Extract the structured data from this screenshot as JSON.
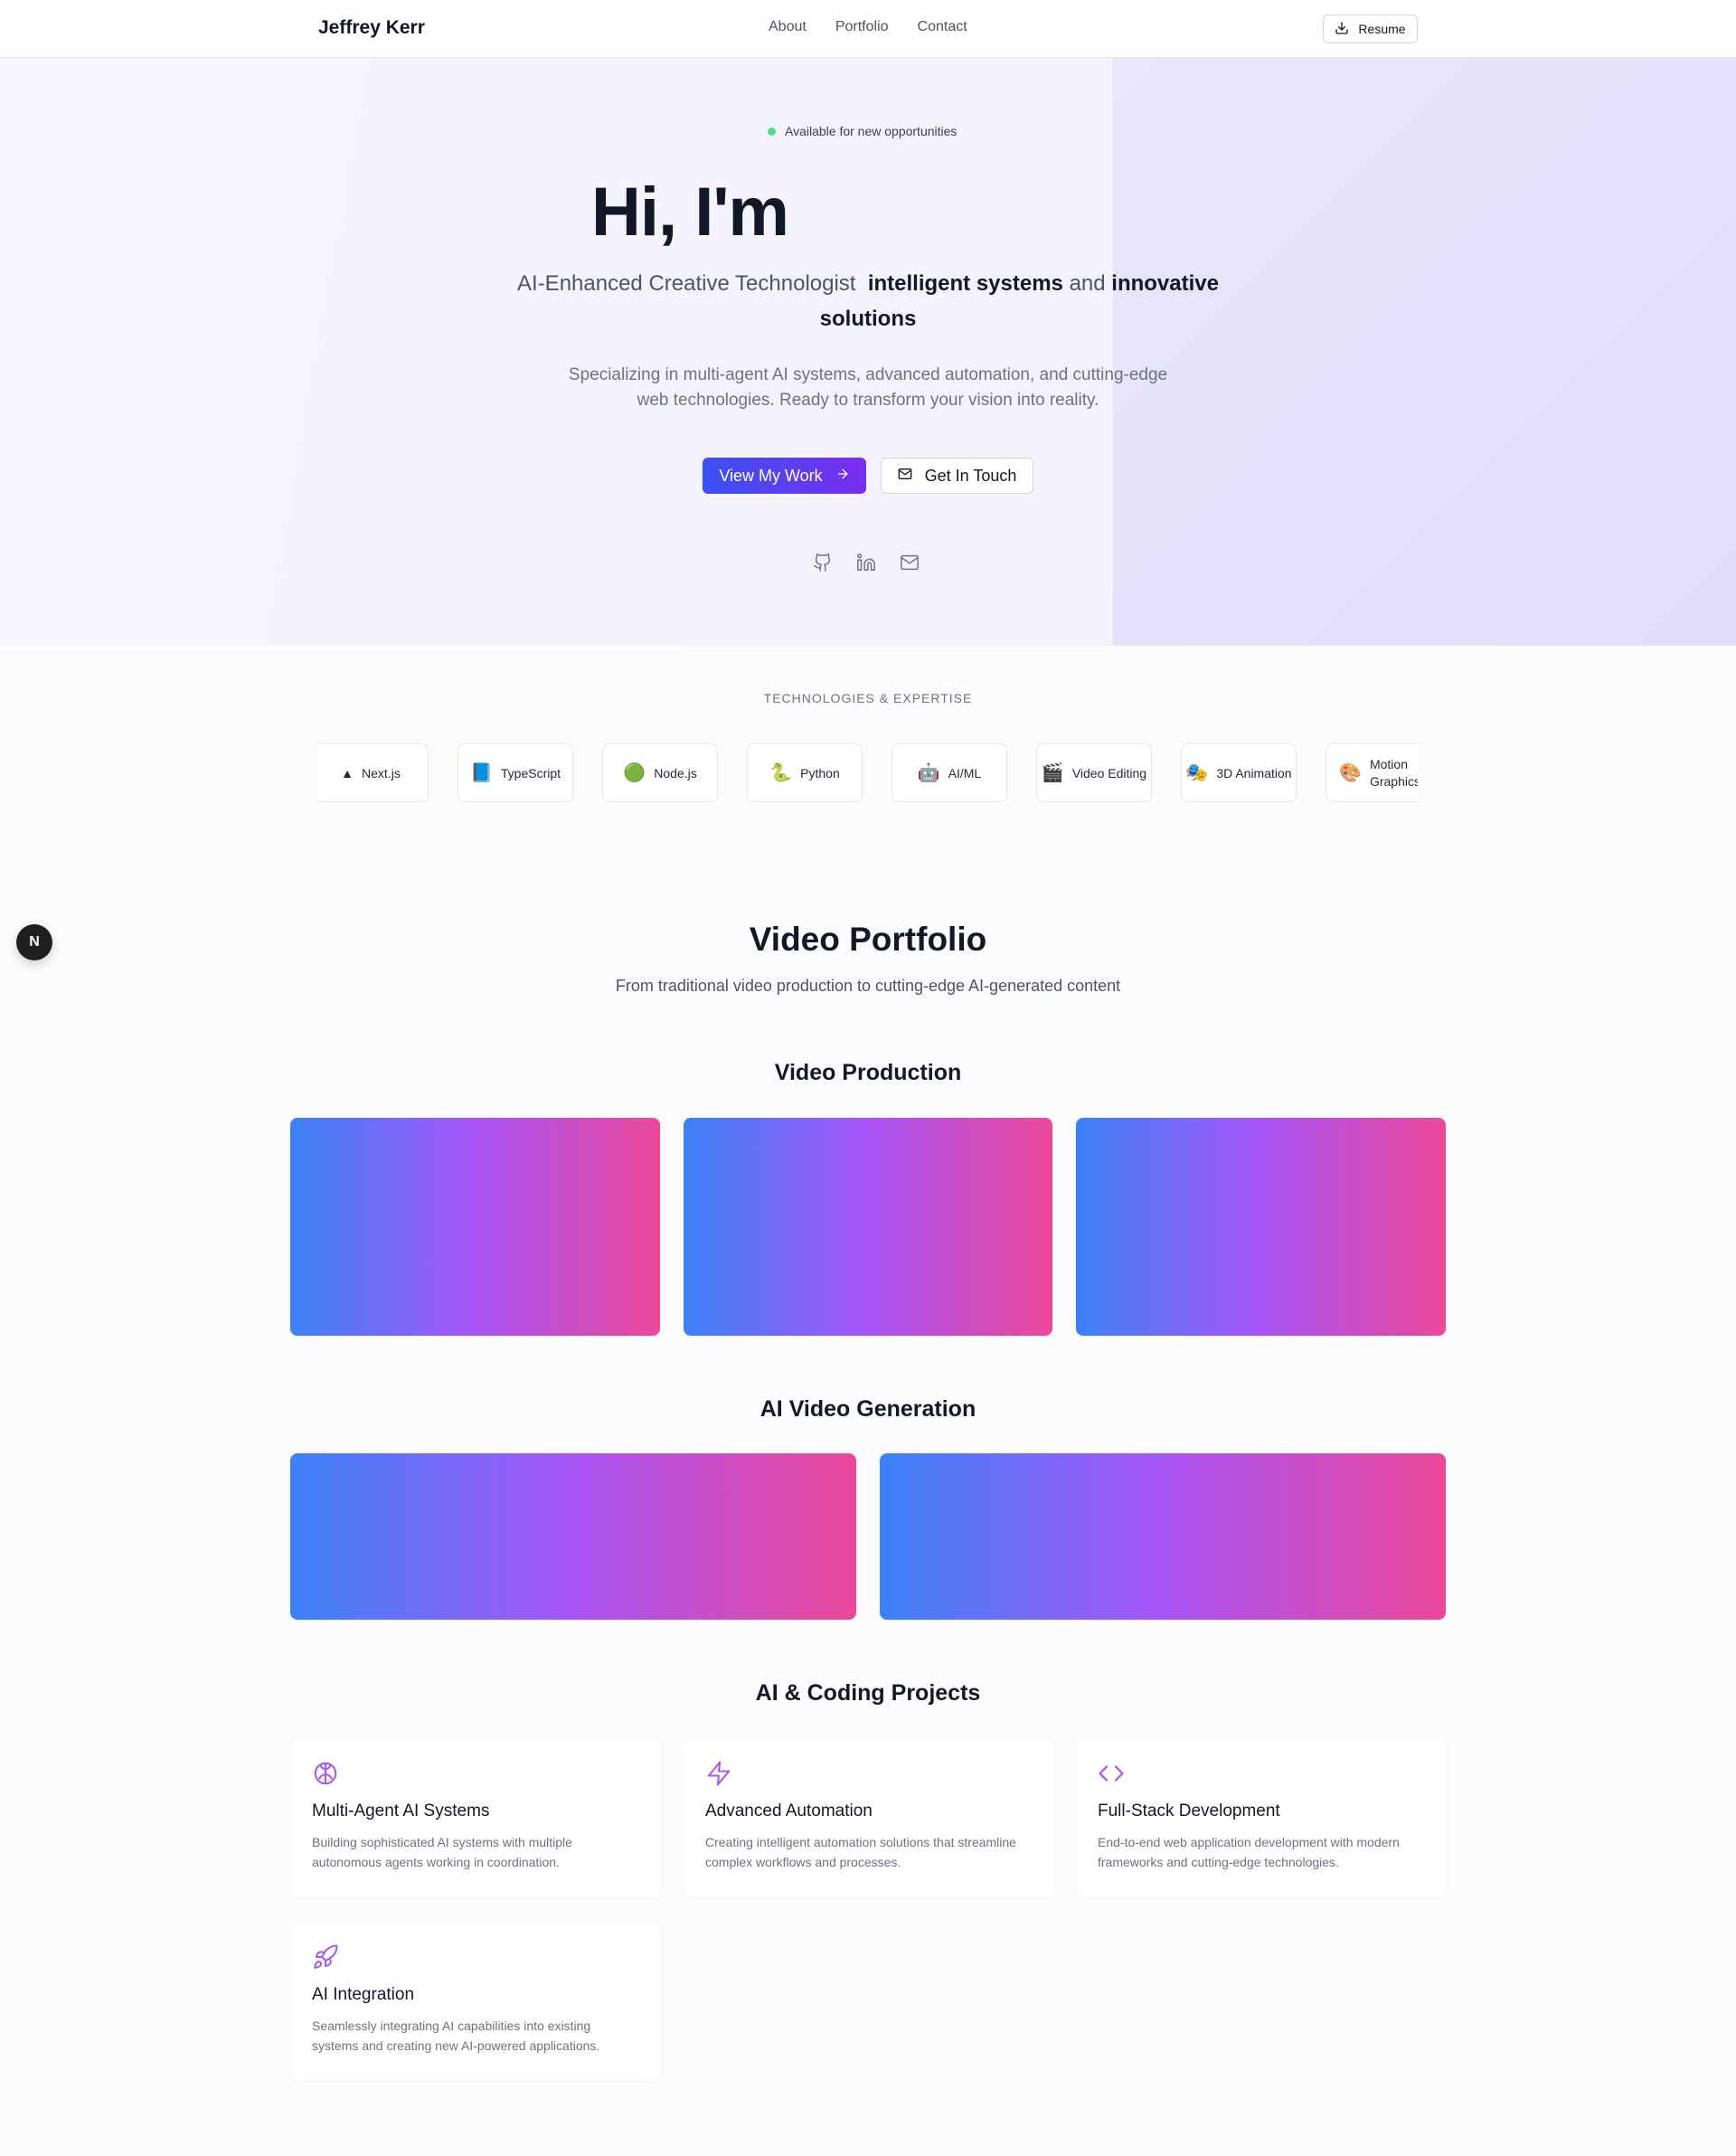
{
  "nav": {
    "brand": "Jeffrey Kerr",
    "links": [
      "About",
      "Portfolio",
      "Contact"
    ],
    "resume_label": "Resume"
  },
  "hero": {
    "availability": "Available for new opportunities",
    "greeting": "Hi, I'm",
    "subtitle_plain_1": "AI-Enhanced Creative Technologist",
    "subtitle_bold_1": "intelligent systems",
    "subtitle_plain_2": "and",
    "subtitle_bold_2": "innovative solutions",
    "description": "Specializing in multi-agent AI systems, advanced automation, and cutting-edge web technologies. Ready to transform your vision into reality.",
    "primary_cta": "View My Work",
    "secondary_cta": "Get In Touch",
    "social_icons": [
      "github-icon",
      "linkedin-icon",
      "mail-icon"
    ]
  },
  "tech": {
    "title": "TECHNOLOGIES & EXPERTISE",
    "items": [
      {
        "emoji": "▲",
        "label": "Next.js"
      },
      {
        "emoji": "📘",
        "label": "TypeScript"
      },
      {
        "emoji": "🟢",
        "label": "Node.js"
      },
      {
        "emoji": "🐍",
        "label": "Python"
      },
      {
        "emoji": "🤖",
        "label": "AI/ML"
      },
      {
        "emoji": "🎬",
        "label": "Video Editing"
      },
      {
        "emoji": "🎭",
        "label": "3D Animation"
      },
      {
        "emoji": "🎨",
        "label": "Motion Graphics"
      }
    ]
  },
  "floating_badge": "N",
  "portfolio": {
    "title": "Video Portfolio",
    "subtitle": "From traditional video production to cutting-edge AI-generated content",
    "video_production_heading": "Video Production",
    "ai_video_heading": "AI Video Generation",
    "coding_heading": "AI & Coding Projects",
    "gradient_colors": [
      "#3b82f6",
      "#a855f7",
      "#ec4899"
    ]
  },
  "projects": [
    {
      "icon": "brain-icon",
      "title": "Multi-Agent AI Systems",
      "description": "Building sophisticated AI systems with multiple autonomous agents working in coordination."
    },
    {
      "icon": "zap-icon",
      "title": "Advanced Automation",
      "description": "Creating intelligent automation solutions that streamline complex workflows and processes."
    },
    {
      "icon": "code-icon",
      "title": "Full-Stack Development",
      "description": "End-to-end web application development with modern frameworks and cutting-edge technologies."
    },
    {
      "icon": "rocket-icon",
      "title": "AI Integration",
      "description": "Seamlessly integrating AI capabilities into existing systems and creating new AI-powered applications."
    }
  ],
  "colors": {
    "accent_purple": "#a855f7",
    "primary_blue": "#3b50f3",
    "status_green": "#4ade80"
  }
}
